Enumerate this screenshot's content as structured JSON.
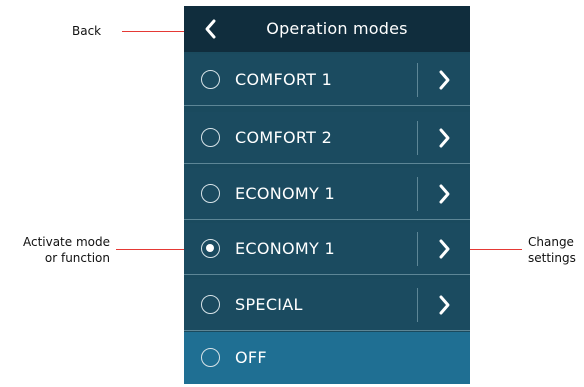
{
  "header": {
    "title": "Operation modes"
  },
  "modes": [
    {
      "label": "COMFORT 1",
      "checked": false,
      "has_settings": true
    },
    {
      "label": "COMFORT 2",
      "checked": false,
      "has_settings": true
    },
    {
      "label": "ECONOMY 1",
      "checked": false,
      "has_settings": true
    },
    {
      "label": "ECONOMY 1",
      "checked": true,
      "has_settings": true
    },
    {
      "label": "SPECIAL",
      "checked": false,
      "has_settings": true
    },
    {
      "label": "OFF",
      "checked": false,
      "has_settings": false
    }
  ],
  "annotations": {
    "back": "Back",
    "activate_line1": "Activate mode",
    "activate_line2": "or function",
    "change_line1": "Change",
    "change_line2": "settings"
  },
  "colors": {
    "header_bg": "#102d3d",
    "row_bg": "#1b4b60",
    "off_row_bg": "#1f6f93",
    "annotation_line": "#e53935"
  },
  "icons": {
    "back": "chevron-left-icon",
    "settings": "chevron-right-icon",
    "radio": "radio-button-icon"
  }
}
